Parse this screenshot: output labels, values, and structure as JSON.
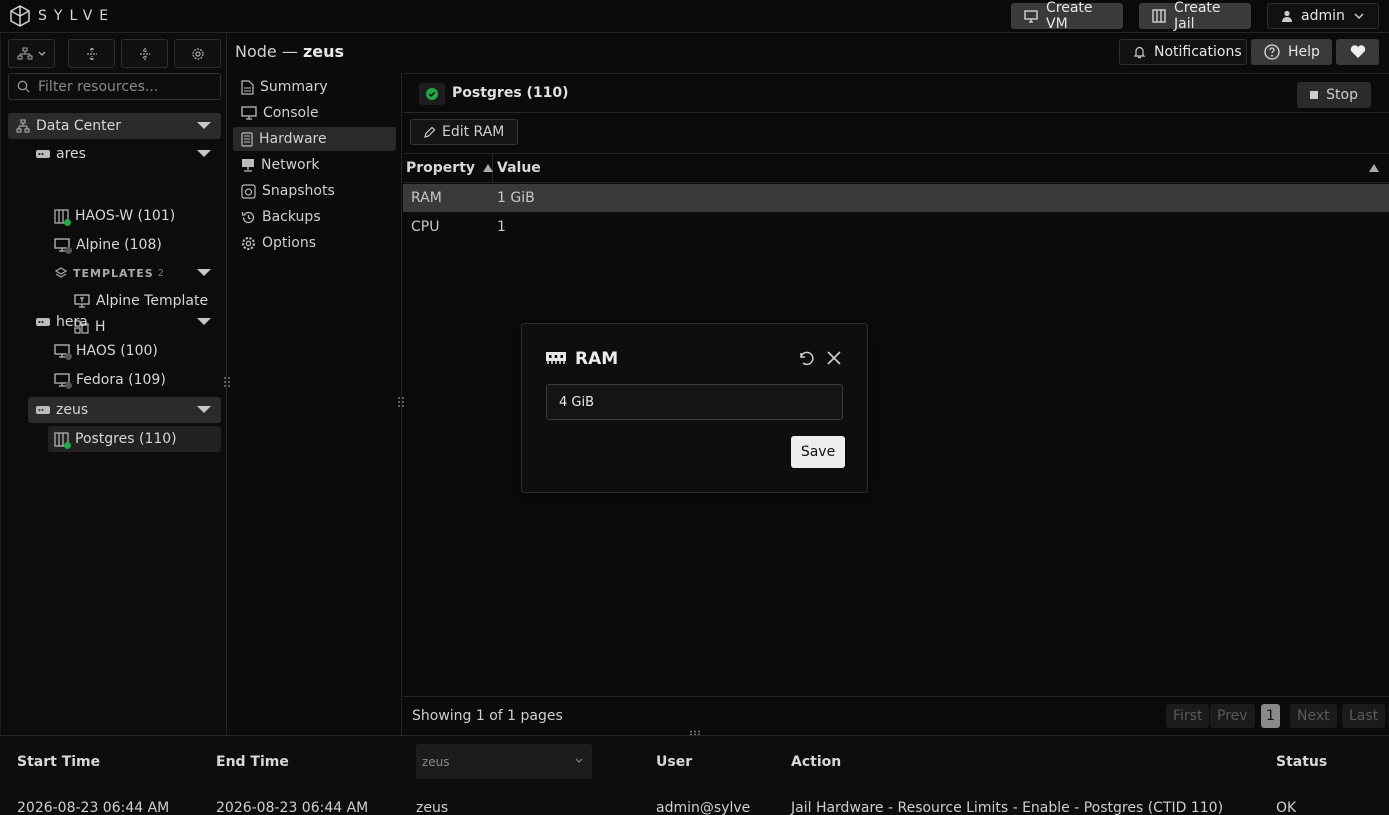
{
  "app": {
    "name": "SYLVE"
  },
  "topbar": {
    "create_vm": "Create VM",
    "create_jail": "Create Jail",
    "user": "admin",
    "notifications": "Notifications",
    "help": "Help"
  },
  "sidebar": {
    "filter_placeholder": "Filter resources...",
    "datacenter": "Data Center",
    "nodes": [
      {
        "name": "ares",
        "items": [
          "HAOS-W (101)",
          "Alpine (108)"
        ],
        "templates_label": "TEMPLATES",
        "templates_count": "2",
        "templates": [
          "Alpine Template",
          "H"
        ]
      },
      {
        "name": "hera",
        "items": [
          "HAOS (100)",
          "Fedora (109)"
        ]
      },
      {
        "name": "zeus",
        "items": [
          "Postgres (110)"
        ]
      }
    ]
  },
  "header": {
    "prefix": "Node —",
    "node": "zeus"
  },
  "nav": {
    "items": [
      "Summary",
      "Console",
      "Hardware",
      "Network",
      "Snapshots",
      "Backups",
      "Options"
    ],
    "active": "Hardware"
  },
  "panel": {
    "title": "Postgres (110)",
    "stop": "Stop",
    "edit_button": "Edit RAM",
    "columns": [
      "Property",
      "Value"
    ],
    "rows": [
      {
        "property": "RAM",
        "value": "1 GiB"
      },
      {
        "property": "CPU",
        "value": "1"
      }
    ],
    "footer": {
      "showing": "Showing 1 of 1 pages",
      "first": "First",
      "prev": "Prev",
      "page": "1",
      "next": "Next",
      "last": "Last"
    }
  },
  "logs": {
    "columns": [
      "Start Time",
      "End Time",
      "User",
      "Action",
      "Status"
    ],
    "node_filter": "zeus",
    "row": {
      "start": "2026-08-23 06:44 AM",
      "end": "2026-08-23 06:44 AM",
      "node": "zeus",
      "user": "admin@sylve",
      "action": "Jail Hardware - Resource Limits - Enable - Postgres (CTID 110)",
      "status": "OK"
    }
  },
  "modal": {
    "title": "RAM",
    "value": "4 GiB",
    "save": "Save"
  },
  "colors": {
    "running": "#22a84a",
    "stopped": "#555555",
    "accent_bg": "#3a3a3a"
  }
}
